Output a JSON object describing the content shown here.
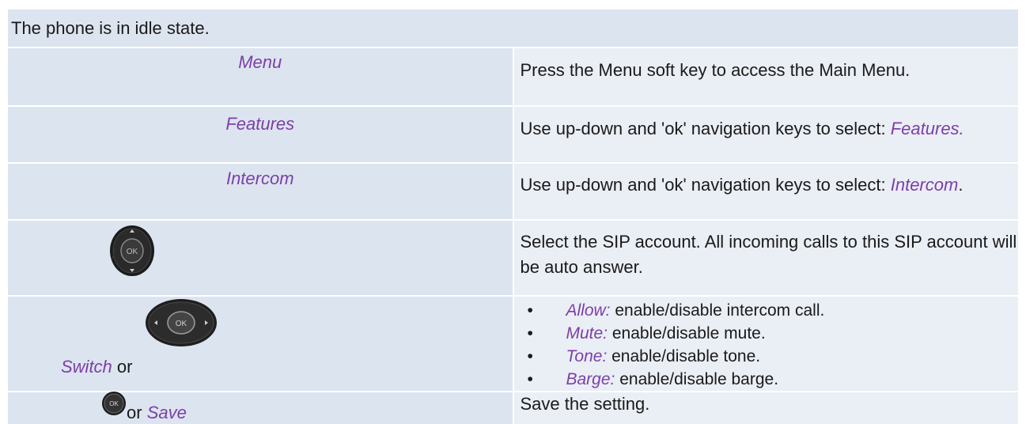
{
  "header": "The phone is in idle state.",
  "rows": {
    "menu": {
      "key": "Menu",
      "desc": "Press the Menu soft key to access the Main Menu."
    },
    "features": {
      "key": "Features",
      "desc_prefix": "Use up-down and 'ok' navigation keys to select: ",
      "desc_italic": "Features."
    },
    "intercom": {
      "key": "Intercom",
      "desc_prefix": "Use up-down and 'ok' navigation keys to select: ",
      "desc_italic": "Intercom",
      "desc_suffix": "."
    },
    "sip": {
      "key_icon": "navigation-ok-key-icon",
      "slash": "/",
      "key_ok_text": "OK",
      "desc": "Select the SIP account. All incoming calls to this SIP account will be auto answer."
    },
    "switch": {
      "key_italic": "Switch",
      "key_or": " or",
      "key_ok_text": "OK",
      "items": [
        {
          "label": "Allow:",
          "text": " enable/disable intercom call."
        },
        {
          "label": "Mute:",
          "text": " enable/disable mute."
        },
        {
          "label": "Tone:",
          "text": " enable/disable tone."
        },
        {
          "label": "Barge:",
          "text": " enable/disable barge."
        }
      ]
    },
    "save": {
      "key_ok_text": "OK",
      "key_or": "or ",
      "key_italic": "Save",
      "desc": "Save the setting."
    }
  },
  "colors": {
    "header_bg": "#dce4ef",
    "cell_bg": "#eaeef5",
    "accent": "#7b3fa8"
  }
}
